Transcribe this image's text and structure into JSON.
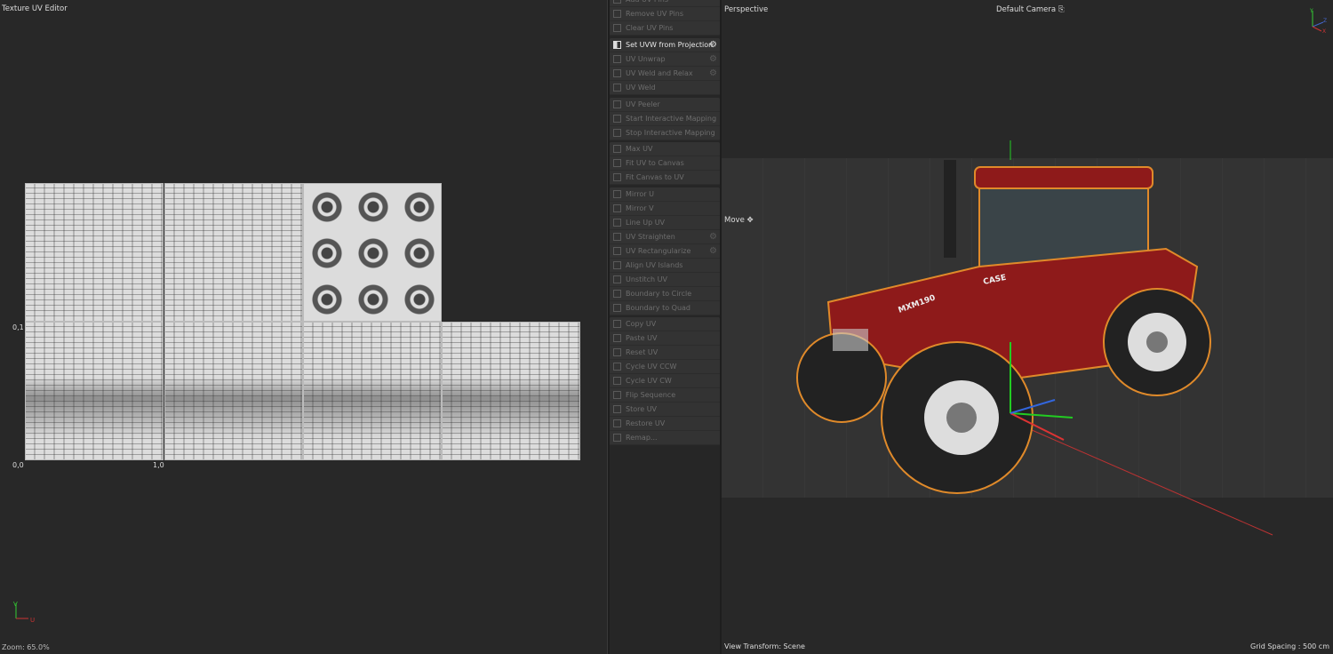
{
  "uv_editor": {
    "title": "Texture UV Editor",
    "zoom": "Zoom: 65.0%",
    "labels": {
      "v1": "0,1",
      "origin": "0,0",
      "u1": "1,0"
    },
    "axis": {
      "v": "V",
      "u": "U"
    }
  },
  "menu": {
    "groups": [
      [
        {
          "label": "Add UV Pins"
        },
        {
          "label": "Remove UV Pins"
        },
        {
          "label": "Clear UV Pins"
        }
      ],
      [
        {
          "label": "Set UVW from Projection",
          "active": true,
          "gear": true
        },
        {
          "label": "UV Unwrap",
          "gear": true
        },
        {
          "label": "UV Weld and Relax",
          "gear": true
        },
        {
          "label": "UV Weld"
        }
      ],
      [
        {
          "label": "UV Peeler"
        },
        {
          "label": "Start Interactive Mapping"
        },
        {
          "label": "Stop Interactive Mapping"
        }
      ],
      [
        {
          "label": "Max UV"
        },
        {
          "label": "Fit UV to Canvas"
        },
        {
          "label": "Fit Canvas to UV"
        }
      ],
      [
        {
          "label": "Mirror U"
        },
        {
          "label": "Mirror V"
        },
        {
          "label": "Line Up UV"
        },
        {
          "label": "UV Straighten",
          "gear": true
        },
        {
          "label": "UV Rectangularize",
          "gear": true
        },
        {
          "label": "Align UV Islands"
        },
        {
          "label": "Unstitch UV"
        },
        {
          "label": "Boundary to Circle"
        },
        {
          "label": "Boundary to Quad"
        }
      ],
      [
        {
          "label": "Copy UV"
        },
        {
          "label": "Paste UV"
        },
        {
          "label": "Reset UV"
        },
        {
          "label": "Cycle UV CCW"
        },
        {
          "label": "Cycle UV CW"
        },
        {
          "label": "Flip Sequence"
        },
        {
          "label": "Store UV"
        },
        {
          "label": "Restore UV"
        },
        {
          "label": "Remap..."
        }
      ]
    ]
  },
  "viewport": {
    "view": "Perspective",
    "camera": "Default Camera",
    "tool": "Move",
    "view_transform": "View Transform: Scene",
    "grid_spacing": "Grid Spacing : 500 cm",
    "model_text": {
      "brand": "CASE",
      "model": "MXM190"
    },
    "axes": {
      "x": "X",
      "y": "Y",
      "z": "Z"
    },
    "colors": {
      "body": "#8e1a1a",
      "outline": "#e08a2a"
    }
  }
}
